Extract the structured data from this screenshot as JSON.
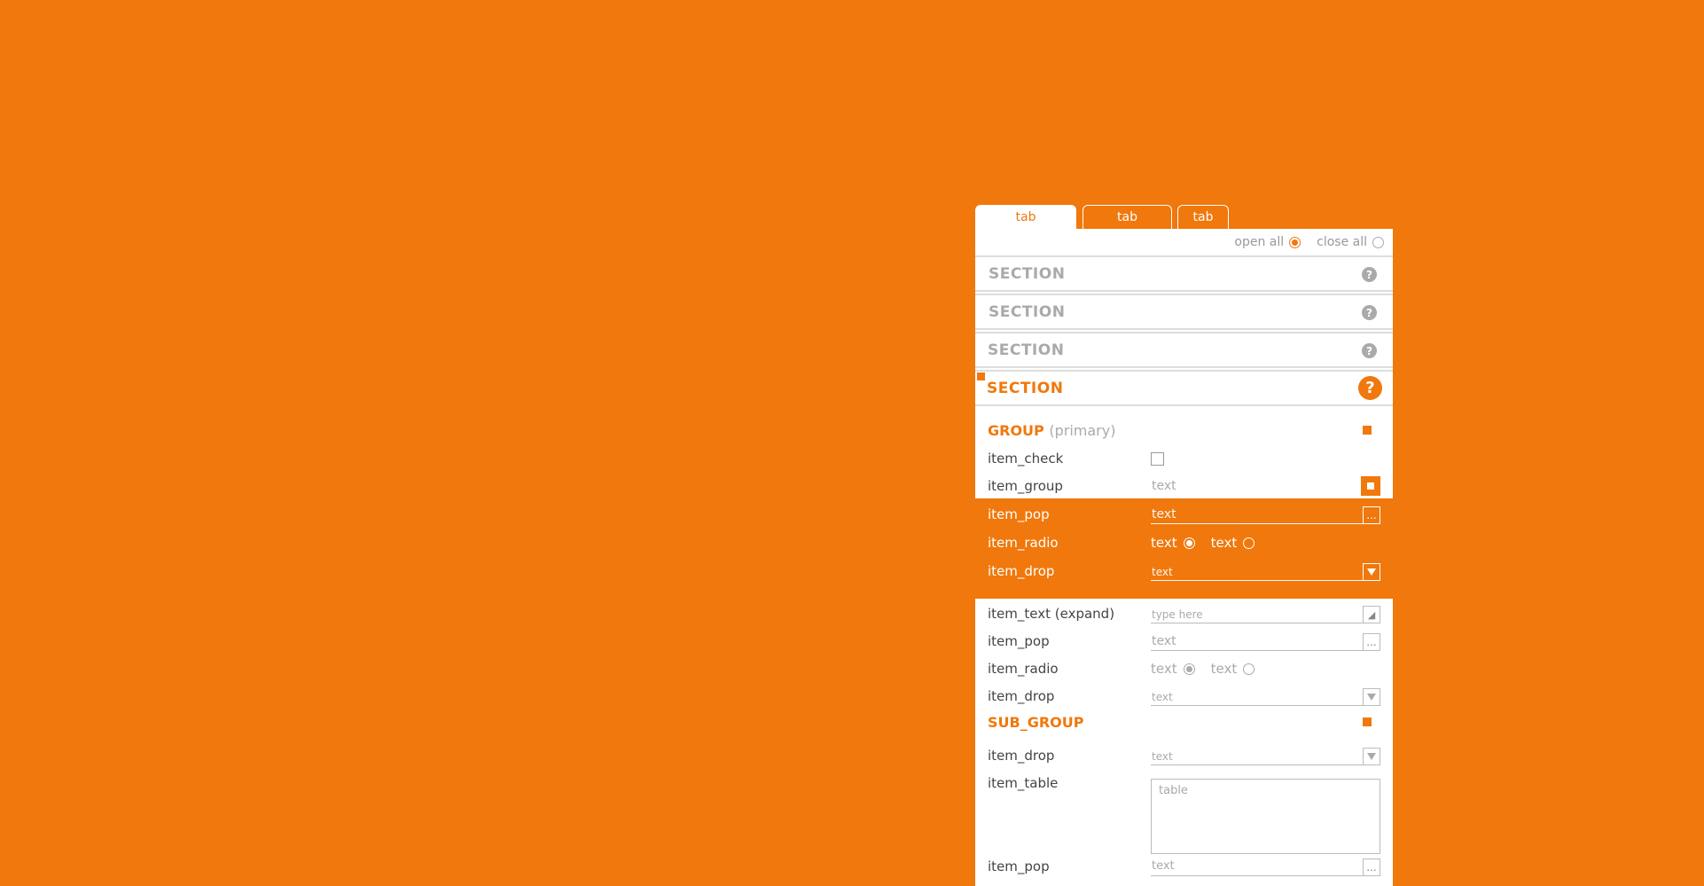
{
  "tabs": [
    "tab",
    "tab",
    "tab"
  ],
  "open_all": "open all",
  "close_all": "close all",
  "sections": [
    "SECTION",
    "SECTION",
    "SECTION",
    "SECTION"
  ],
  "help_glyph": "?",
  "group": {
    "title": "GROUP",
    "subtitle": "(primary)"
  },
  "rows": {
    "item_check": "item_check",
    "item_group": {
      "label": "item_group",
      "value": "text"
    },
    "pop1": {
      "label": "item_pop",
      "value": "text",
      "btn": "..."
    },
    "radio1": {
      "label": "item_radio",
      "opt1": "text",
      "opt2": "text"
    },
    "drop1": {
      "label": "item_drop",
      "value": "text"
    },
    "text_expand": {
      "label": "item_text (expand)",
      "placeholder": "type here"
    },
    "pop2": {
      "label": "item_pop",
      "value": "text",
      "btn": "..."
    },
    "radio2": {
      "label": "item_radio",
      "opt1": "text",
      "opt2": "text"
    },
    "drop2": {
      "label": "item_drop",
      "value": "text"
    }
  },
  "sub_group": {
    "title": "SUB_GROUP",
    "drop": {
      "label": "item_drop",
      "value": "text"
    },
    "table": {
      "label": "item_table",
      "placeholder": "table"
    },
    "pop": {
      "label": "item_pop",
      "value": "text",
      "btn": "..."
    }
  },
  "colors": {
    "accent": "#F0780C",
    "panel": "#FFFFFF"
  },
  "icons": [
    "help-icon",
    "dropdown-arrow-icon",
    "expand-icon",
    "popup-dots-icon"
  ]
}
